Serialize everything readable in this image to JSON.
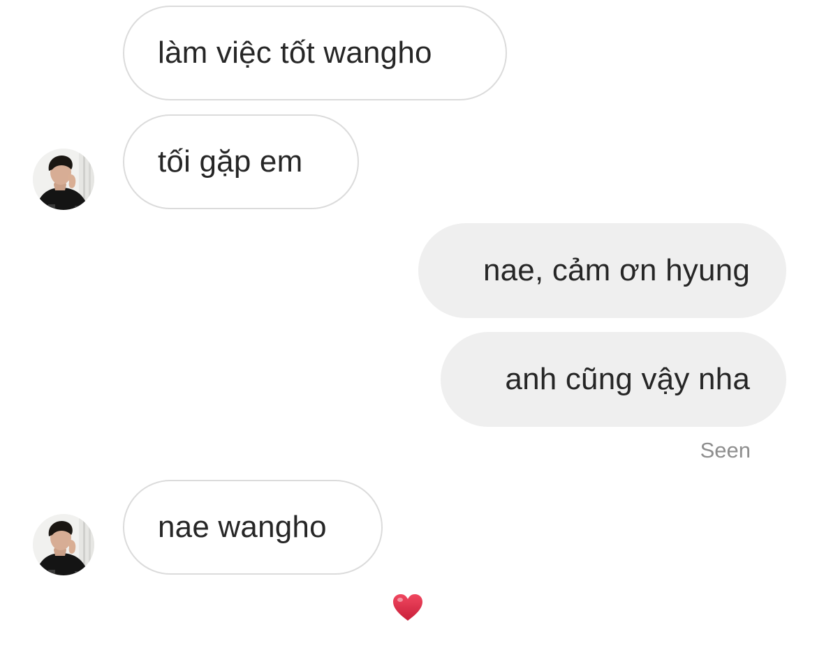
{
  "messages": [
    {
      "text": "làm việc tốt wangho",
      "direction": "incoming"
    },
    {
      "text": "tối gặp em",
      "direction": "incoming",
      "avatar": "profile-photo"
    },
    {
      "text": "nae, cảm ơn hyung",
      "direction": "outgoing"
    },
    {
      "text": "anh cũng vậy nha",
      "direction": "outgoing"
    },
    {
      "text": "nae wangho",
      "direction": "incoming",
      "avatar": "profile-photo"
    }
  ],
  "status": {
    "seen": "Seen"
  },
  "reaction": {
    "icon": "heart-icon",
    "color": "#e0314b"
  },
  "colors": {
    "incoming_bubble_border": "#dbdbdb",
    "outgoing_bubble_bg": "#efefef",
    "text": "#262626",
    "muted": "#8e8e8e"
  }
}
